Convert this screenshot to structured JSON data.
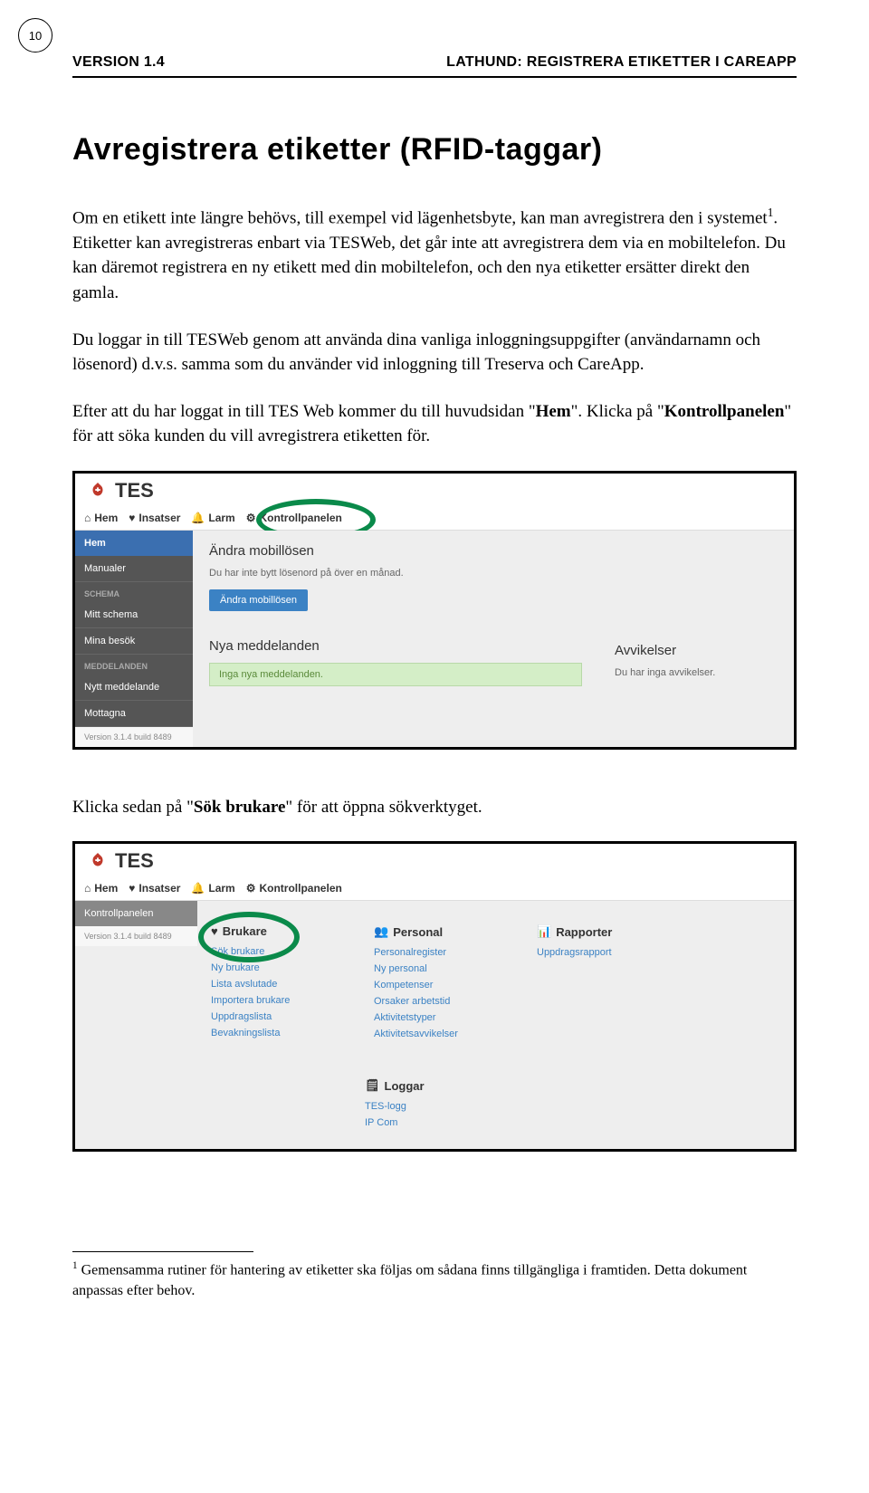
{
  "pageNumber": "10",
  "headerLeft": "VERSION 1.4",
  "headerRight": "LATHUND: REGISTRERA ETIKETTER I CAREAPP",
  "title": "Avregistrera etiketter (RFID-taggar)",
  "para1a": "Om en etikett inte längre behövs, till exempel vid lägenhetsbyte, kan man avregistrera den i systemet",
  "para1sup": "1",
  "para1b": ". Etiketter kan avregistreras enbart via TESWeb, det går inte att avregistrera dem via en mobiltelefon. Du kan däremot registrera en ny etikett med din mobiltelefon, och den nya etiketter ersätter direkt den gamla.",
  "para2": "Du loggar in till TESWeb genom att använda dina vanliga inloggningsuppgifter (användarnamn och lösenord) d.v.s. samma som du använder vid inloggning till Treserva och CareApp.",
  "para3a": "Efter att du har loggat in till TES Web kommer du till huvudsidan \"",
  "para3b": "Hem",
  "para3c": "\". Klicka på \"",
  "para3d": "Kontrollpanelen",
  "para3e": "\" för att söka kunden du vill avregistrera etiketten för.",
  "shot1": {
    "logo": "TES",
    "nav": {
      "hem": "Hem",
      "insatser": "Insatser",
      "larm": "Larm",
      "kp": "Kontrollpanelen"
    },
    "side": {
      "active": "Hem",
      "manualer": "Manualer",
      "schema": "SCHEMA",
      "mittschema": "Mitt schema",
      "minabesok": "Mina besök",
      "meddelanden": "MEDDELANDEN",
      "nytt": "Nytt meddelande",
      "mottagna": "Mottagna",
      "ver": "Version 3.1.4 build 8489"
    },
    "section1": "Ändra mobillösen",
    "sub1": "Du har inte bytt lösenord på över en månad.",
    "btn": "Ändra mobillösen",
    "section2": "Nya meddelanden",
    "msg": "Inga nya meddelanden.",
    "section3": "Avvikelser",
    "sub3": "Du har inga avvikelser."
  },
  "para4a": "Klicka sedan på \"",
  "para4b": "Sök brukare",
  "para4c": "\" för att öppna sökverktyget.",
  "shot2": {
    "logo": "TES",
    "nav": {
      "hem": "Hem",
      "insatser": "Insatser",
      "larm": "Larm",
      "kp": "Kontrollpanelen"
    },
    "sideItem": "Kontrollpanelen",
    "ver": "Version 3.1.4 build 8489",
    "col1": {
      "h": "Brukare",
      "items": [
        "Sök brukare",
        "Ny brukare",
        "Lista avslutade",
        "Importera brukare",
        "Uppdragslista",
        "Bevakningslista"
      ]
    },
    "col2": {
      "h": "Personal",
      "items": [
        "Personalregister",
        "Ny personal",
        "Kompetenser",
        "Orsaker arbetstid",
        "Aktivitetstyper",
        "Aktivitetsavvikelser"
      ]
    },
    "col3": {
      "h": "Rapporter",
      "items": [
        "Uppdragsrapport"
      ]
    },
    "loggar": {
      "h": "Loggar",
      "items": [
        "TES-logg",
        "IP Com"
      ]
    }
  },
  "footnoteNum": "1",
  "footnote": " Gemensamma rutiner för hantering av etiketter ska följas om sådana finns tillgängliga i framtiden. Detta dokument anpassas efter behov."
}
